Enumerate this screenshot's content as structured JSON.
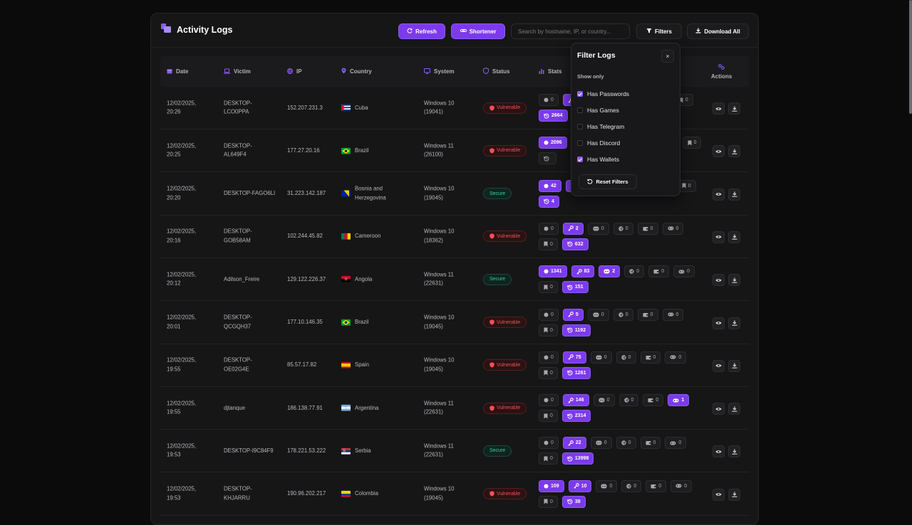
{
  "header": {
    "title": "Activity Logs",
    "refresh_label": "Refresh",
    "shortener_label": "Shortener",
    "search_placeholder": "Search by hostname, IP, or country...",
    "filters_label": "Filters",
    "download_all_label": "Download All"
  },
  "columns": {
    "date": "Date",
    "victim": "Victim",
    "ip": "IP",
    "country": "Country",
    "system": "System",
    "status": "Status",
    "stats": "Stats",
    "actions": "Actions"
  },
  "filter_panel": {
    "title": "Filter Logs",
    "close_label": "×",
    "subtitle": "Show only",
    "options": [
      {
        "label": "Has Passwords",
        "checked": true
      },
      {
        "label": "Has Games",
        "checked": false
      },
      {
        "label": "Has Telegram",
        "checked": false
      },
      {
        "label": "Has Discord",
        "checked": false
      },
      {
        "label": "Has Wallets",
        "checked": true
      }
    ],
    "reset_label": "Reset Filters"
  },
  "rows": [
    {
      "date": "12/02/2025,\n20:26",
      "victim": "DESKTOP-\nLCO0PPA",
      "ip": "152.207.231.3",
      "country": "Cuba",
      "flag": "cuba",
      "system": "Windows 10\n(19041)",
      "status": "Vulnerable",
      "stats": [
        {
          "icon": "circle",
          "v": "0",
          "on": false
        },
        {
          "icon": "key",
          "v": "",
          "on": true
        },
        {
          "icon": "discord",
          "v": "",
          "on": false
        },
        {
          "icon": "tg",
          "v": "",
          "on": false
        },
        {
          "icon": "wallet",
          "v": "",
          "on": false
        },
        {
          "icon": "game",
          "v": "",
          "on": false
        },
        {
          "icon": "bookmark",
          "v": "0",
          "on": false
        },
        {
          "icon": "history",
          "v": "2664",
          "on": true
        }
      ]
    },
    {
      "date": "12/02/2025,\n20:25",
      "victim": "DESKTOP-\nAL649F4",
      "ip": "177.27.20.16",
      "country": "Brazil",
      "flag": "brazil",
      "system": "Windows 11\n(26100)",
      "status": "Vulnerable",
      "stats": [
        {
          "icon": "circle",
          "v": "2096",
          "on": true
        },
        {
          "icon": "key",
          "v": "",
          "on": false
        },
        {
          "icon": "discord",
          "v": "",
          "on": false
        },
        {
          "icon": "tg",
          "v": "",
          "on": false
        },
        {
          "icon": "wallet",
          "v": "",
          "on": false
        },
        {
          "icon": "game",
          "v": "",
          "on": false
        },
        {
          "icon": "bookmark",
          "v": "0",
          "on": false
        },
        {
          "icon": "history",
          "v": "",
          "on": false
        }
      ]
    },
    {
      "date": "12/02/2025,\n20:20",
      "victim": "DESKTOP-FAGO6LI",
      "ip": "31.223.142.187",
      "country": "Bosnia and\nHerzegovina",
      "flag": "bosnia",
      "system": "Windows 10\n(19045)",
      "status": "Secure",
      "stats": [
        {
          "icon": "circle",
          "v": "42",
          "on": true
        },
        {
          "icon": "key",
          "v": "",
          "on": true
        },
        {
          "icon": "discord",
          "v": "",
          "on": false
        },
        {
          "icon": "tg",
          "v": "",
          "on": false
        },
        {
          "icon": "wallet",
          "v": "",
          "on": false
        },
        {
          "icon": "game",
          "v": "",
          "on": false
        },
        {
          "icon": "bookmark",
          "v": "0",
          "on": false
        },
        {
          "icon": "history",
          "v": "4",
          "on": true
        }
      ]
    },
    {
      "date": "12/02/2025,\n20:16",
      "victim": "DESKTOP-\nGOB58AM",
      "ip": "102.244.45.82",
      "country": "Cameroon",
      "flag": "cameroon",
      "system": "Windows 10\n(18362)",
      "status": "Vulnerable",
      "stats": [
        {
          "icon": "circle",
          "v": "0",
          "on": false
        },
        {
          "icon": "key",
          "v": "2",
          "on": true
        },
        {
          "icon": "discord",
          "v": "0",
          "on": false
        },
        {
          "icon": "tg",
          "v": "0",
          "on": false
        },
        {
          "icon": "wallet",
          "v": "0",
          "on": false
        },
        {
          "icon": "game",
          "v": "0",
          "on": false
        },
        {
          "icon": "bookmark",
          "v": "0",
          "on": false
        },
        {
          "icon": "history",
          "v": "632",
          "on": true
        }
      ]
    },
    {
      "date": "12/02/2025,\n20:12",
      "victim": "Adilson_Freire",
      "ip": "129.122.226.37",
      "country": "Angola",
      "flag": "angola",
      "system": "Windows 11\n(22631)",
      "status": "Secure",
      "stats": [
        {
          "icon": "circle",
          "v": "1341",
          "on": true
        },
        {
          "icon": "key",
          "v": "83",
          "on": true
        },
        {
          "icon": "discord",
          "v": "2",
          "on": true
        },
        {
          "icon": "tg",
          "v": "0",
          "on": false
        },
        {
          "icon": "wallet",
          "v": "0",
          "on": false
        },
        {
          "icon": "game",
          "v": "0",
          "on": false
        },
        {
          "icon": "bookmark",
          "v": "0",
          "on": false
        },
        {
          "icon": "history",
          "v": "151",
          "on": true
        }
      ]
    },
    {
      "date": "12/02/2025,\n20:01",
      "victim": "DESKTOP-\nQCGQH37",
      "ip": "177.10.146.35",
      "country": "Brazil",
      "flag": "brazil",
      "system": "Windows 10\n(19045)",
      "status": "Vulnerable",
      "stats": [
        {
          "icon": "circle",
          "v": "0",
          "on": false
        },
        {
          "icon": "key",
          "v": "5",
          "on": true
        },
        {
          "icon": "discord",
          "v": "0",
          "on": false
        },
        {
          "icon": "tg",
          "v": "0",
          "on": false
        },
        {
          "icon": "wallet",
          "v": "0",
          "on": false
        },
        {
          "icon": "game",
          "v": "0",
          "on": false
        },
        {
          "icon": "bookmark",
          "v": "0",
          "on": false
        },
        {
          "icon": "history",
          "v": "1192",
          "on": true
        }
      ]
    },
    {
      "date": "12/02/2025,\n19:55",
      "victim": "DESKTOP-\nOE02G4E",
      "ip": "85.57.17.82",
      "country": "Spain",
      "flag": "spain",
      "system": "Windows 10\n(19045)",
      "status": "Vulnerable",
      "stats": [
        {
          "icon": "circle",
          "v": "0",
          "on": false
        },
        {
          "icon": "key",
          "v": "75",
          "on": true
        },
        {
          "icon": "discord",
          "v": "0",
          "on": false
        },
        {
          "icon": "tg",
          "v": "0",
          "on": false
        },
        {
          "icon": "wallet",
          "v": "0",
          "on": false
        },
        {
          "icon": "game",
          "v": "0",
          "on": false
        },
        {
          "icon": "bookmark",
          "v": "0",
          "on": false
        },
        {
          "icon": "history",
          "v": "1261",
          "on": true
        }
      ]
    },
    {
      "date": "12/02/2025,\n19:55",
      "victim": "djtanque",
      "ip": "186.138.77.91",
      "country": "Argentina",
      "flag": "argentina",
      "system": "Windows 11\n(22631)",
      "status": "Vulnerable",
      "stats": [
        {
          "icon": "circle",
          "v": "0",
          "on": false
        },
        {
          "icon": "key",
          "v": "146",
          "on": true
        },
        {
          "icon": "discord",
          "v": "0",
          "on": false
        },
        {
          "icon": "tg",
          "v": "0",
          "on": false
        },
        {
          "icon": "wallet",
          "v": "0",
          "on": false
        },
        {
          "icon": "game",
          "v": "1",
          "on": true
        },
        {
          "icon": "bookmark",
          "v": "0",
          "on": false
        },
        {
          "icon": "history",
          "v": "2314",
          "on": true
        }
      ]
    },
    {
      "date": "12/02/2025,\n19:53",
      "victim": "DESKTOP-I9C84F9",
      "ip": "178.221.53.222",
      "country": "Serbia",
      "flag": "serbia",
      "system": "Windows 11\n(22631)",
      "status": "Secure",
      "stats": [
        {
          "icon": "circle",
          "v": "0",
          "on": false
        },
        {
          "icon": "key",
          "v": "22",
          "on": true
        },
        {
          "icon": "discord",
          "v": "0",
          "on": false
        },
        {
          "icon": "tg",
          "v": "0",
          "on": false
        },
        {
          "icon": "wallet",
          "v": "0",
          "on": false
        },
        {
          "icon": "game",
          "v": "0",
          "on": false
        },
        {
          "icon": "bookmark",
          "v": "0",
          "on": false
        },
        {
          "icon": "history",
          "v": "13998",
          "on": true
        }
      ]
    },
    {
      "date": "12/02/2025,\n19:53",
      "victim": "DESKTOP-\nKHJARRU",
      "ip": "190.96.202.217",
      "country": "Colombia",
      "flag": "colombia",
      "system": "Windows 10\n(19045)",
      "status": "Vulnerable",
      "stats": [
        {
          "icon": "circle",
          "v": "109",
          "on": true
        },
        {
          "icon": "key",
          "v": "10",
          "on": true
        },
        {
          "icon": "discord",
          "v": "0",
          "on": false
        },
        {
          "icon": "tg",
          "v": "0",
          "on": false
        },
        {
          "icon": "wallet",
          "v": "0",
          "on": false
        },
        {
          "icon": "game",
          "v": "0",
          "on": false
        },
        {
          "icon": "bookmark",
          "v": "0",
          "on": false
        },
        {
          "icon": "history",
          "v": "38",
          "on": true
        }
      ]
    }
  ],
  "colors": {
    "accent": "#7c3aed",
    "vulnerable": "#f05252",
    "secure": "#34d399"
  }
}
